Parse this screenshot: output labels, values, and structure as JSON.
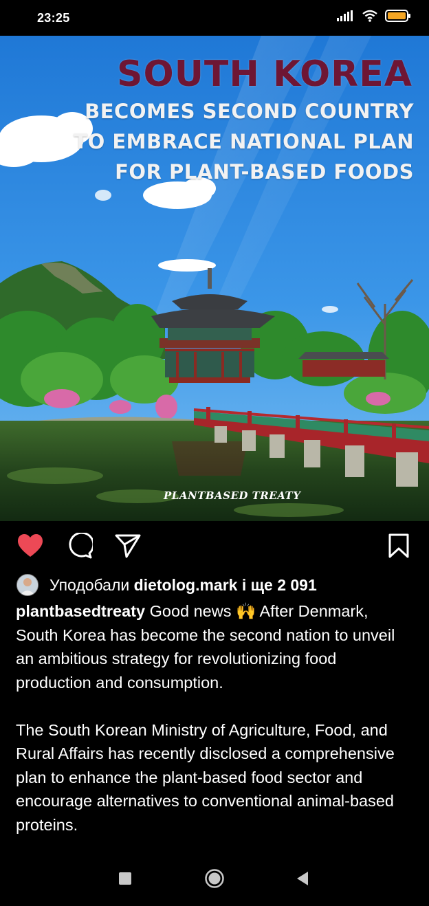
{
  "status_bar": {
    "time": "23:25",
    "icons": [
      "signal-icon",
      "wifi-icon",
      "battery-icon"
    ],
    "battery_color": "#f5a623"
  },
  "post": {
    "image": {
      "headline_main": "SOUTH KOREA",
      "headline_sub": "BECOMES SECOND COUNTRY TO EMBRACE NATIONAL PLAN FOR PLANT-BASED FOODS",
      "watermark": "PLANTBASED TREATY"
    },
    "actions": {
      "like_icon": "heart-icon",
      "comment_icon": "comment-icon",
      "share_icon": "send-icon",
      "save_icon": "bookmark-icon",
      "like_color": "#ed4956"
    },
    "likes": {
      "prefix": "Уподобали",
      "user": "dietolog.mark",
      "suffix": "і ще 2 091"
    },
    "caption": {
      "username": "plantbasedtreaty",
      "paragraph1": "Good news 🙌 After Denmark, South Korea has become the second nation to unveil an ambitious strategy for revolutionizing food production and consumption.",
      "paragraph2": "The South Korean Ministry of Agriculture, Food, and Rural Affairs has recently disclosed a comprehensive plan to enhance the plant-based food sector and encourage alternatives to conventional animal-based proteins."
    }
  },
  "nav_bar": {
    "icons": [
      "recents-square-icon",
      "home-circle-icon",
      "back-triangle-icon"
    ]
  }
}
